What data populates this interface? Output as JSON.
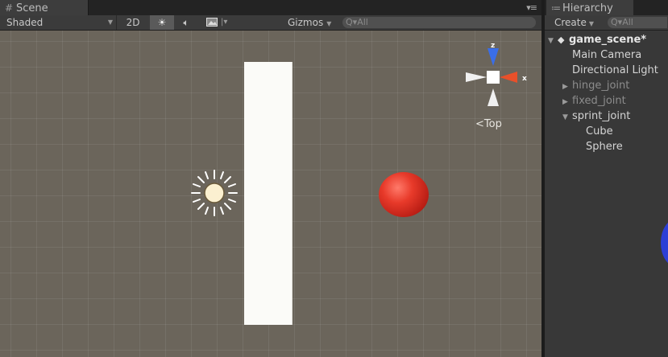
{
  "scene": {
    "tab_label": "Scene",
    "tab_icon": "grid-icon",
    "toolbar": {
      "shading_mode": "Shaded",
      "mode_2d_label": "2D",
      "gizmos_label": "Gizmos",
      "search_placeholder": "All"
    },
    "gizmo_view_label": "Top",
    "gizmo_axis_x": "x",
    "gizmo_axis_z": "z"
  },
  "hierarchy": {
    "tab_label": "Hierarchy",
    "tab_icon": "list-icon",
    "create_label": "Create",
    "search_placeholder": "All",
    "scene_name": "game_scene*",
    "items": [
      {
        "label": "Main Camera"
      },
      {
        "label": "Directional Light"
      },
      {
        "label": "hinge_joint"
      },
      {
        "label": "fixed_joint"
      },
      {
        "label": "sprint_joint"
      },
      {
        "label": "Cube"
      },
      {
        "label": "Sphere"
      }
    ]
  },
  "colors": {
    "gizmo_x": "#e8502a",
    "gizmo_z": "#3a6ee8",
    "sphere": "#e83a2a"
  }
}
